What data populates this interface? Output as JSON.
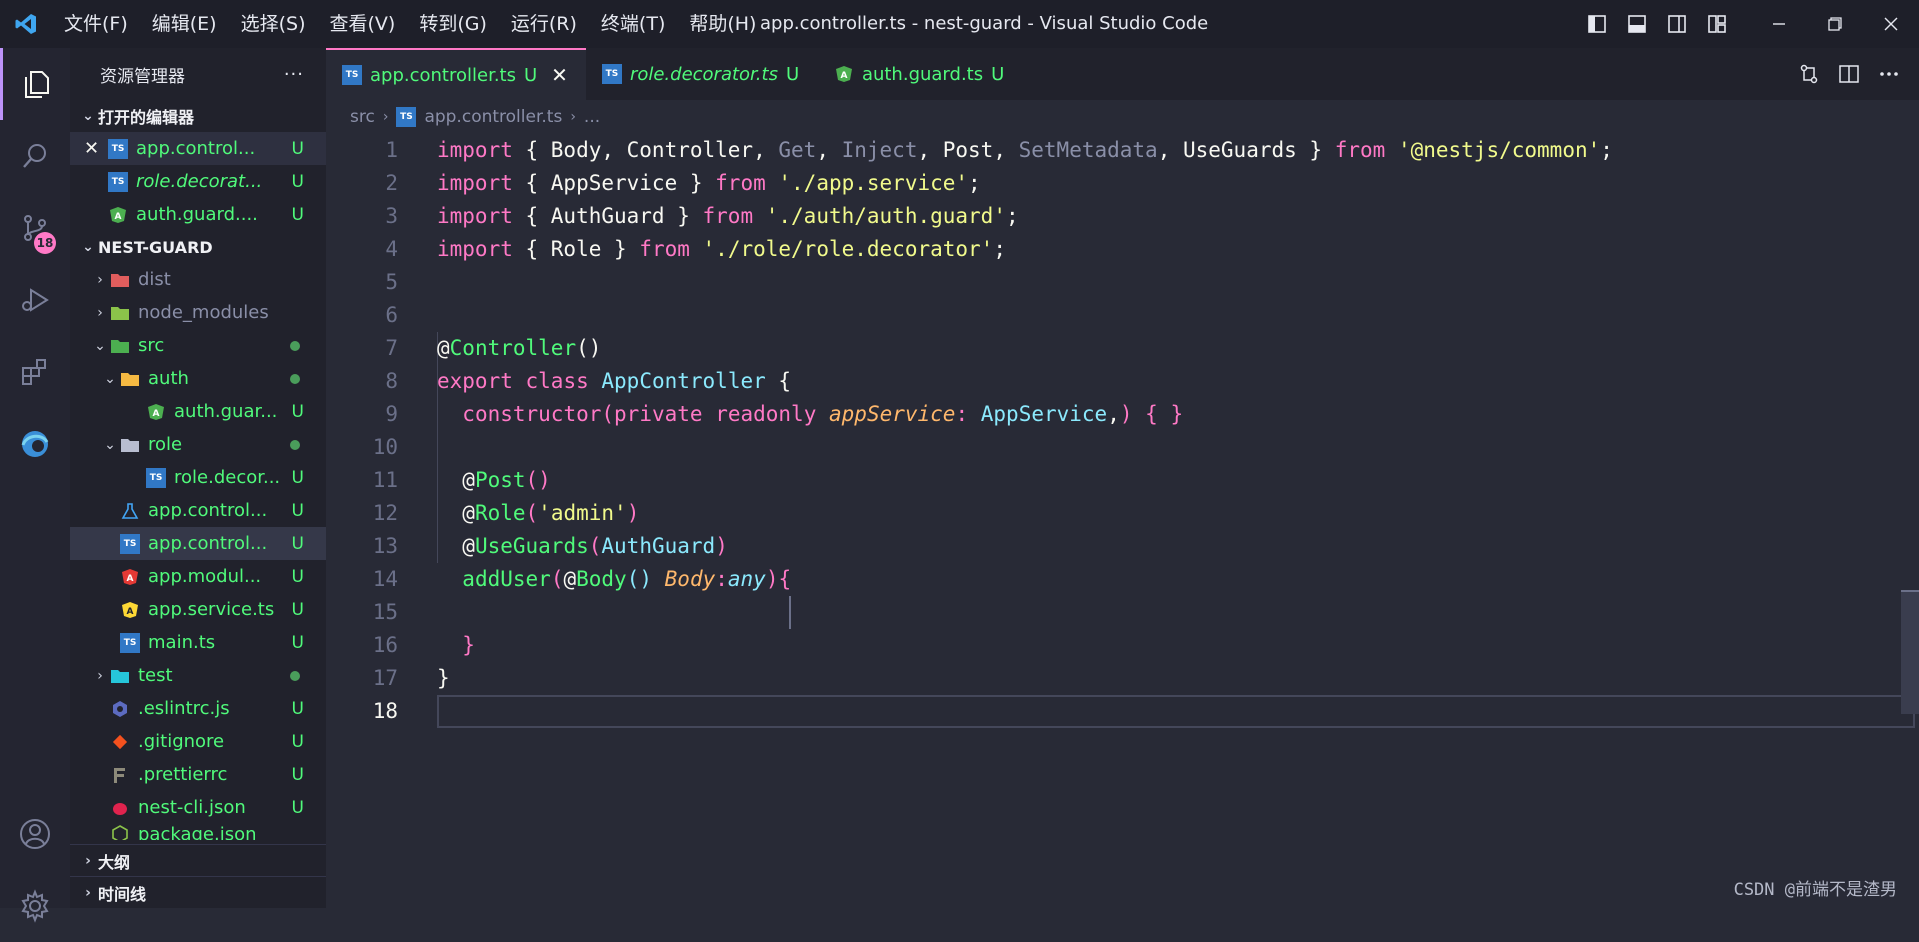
{
  "menu": [
    "文件(F)",
    "编辑(E)",
    "选择(S)",
    "查看(V)",
    "转到(G)",
    "运行(R)",
    "终端(T)",
    "帮助(H)"
  ],
  "window_title": "app.controller.ts - nest-guard - Visual Studio Code",
  "activity": {
    "scm_badge": "18"
  },
  "sidebar": {
    "title": "资源管理器",
    "more": "···",
    "open_editors": {
      "label": "打开的编辑器",
      "items": [
        {
          "name": "app.control...",
          "status": "U"
        },
        {
          "name": "role.decorat...",
          "status": "U"
        },
        {
          "name": "auth.guard....",
          "status": "U"
        }
      ]
    },
    "project": {
      "label": "NEST-GUARD",
      "items": [
        {
          "name": "dist"
        },
        {
          "name": "node_modules"
        },
        {
          "name": "src"
        },
        {
          "name": "auth"
        },
        {
          "name": "auth.guar...",
          "status": "U"
        },
        {
          "name": "role"
        },
        {
          "name": "role.decor...",
          "status": "U"
        },
        {
          "name": "app.control...",
          "status": "U"
        },
        {
          "name": "app.control...",
          "status": "U"
        },
        {
          "name": "app.modul...",
          "status": "U"
        },
        {
          "name": "app.service.ts",
          "status": "U"
        },
        {
          "name": "main.ts",
          "status": "U"
        },
        {
          "name": "test"
        },
        {
          "name": ".eslintrc.js",
          "status": "U"
        },
        {
          "name": ".gitignore",
          "status": "U"
        },
        {
          "name": ".prettierrc",
          "status": "U"
        },
        {
          "name": "nest-cli.json",
          "status": "U"
        },
        {
          "name": "package.json"
        }
      ]
    },
    "outline": "大纲",
    "timeline": "时间线"
  },
  "tabs": [
    {
      "name": "app.controller.ts",
      "status": "U"
    },
    {
      "name": "role.decorator.ts",
      "status": "U"
    },
    {
      "name": "auth.guard.ts",
      "status": "U"
    }
  ],
  "breadcrumb": {
    "folder": "src",
    "file": "app.controller.ts",
    "more": "..."
  },
  "editor": {
    "line_numbers": [
      "1",
      "2",
      "3",
      "4",
      "5",
      "6",
      "7",
      "8",
      "9",
      "10",
      "11",
      "12",
      "13",
      "14",
      "15",
      "16",
      "17",
      "18"
    ]
  },
  "watermark": "CSDN @前端不是渣男"
}
